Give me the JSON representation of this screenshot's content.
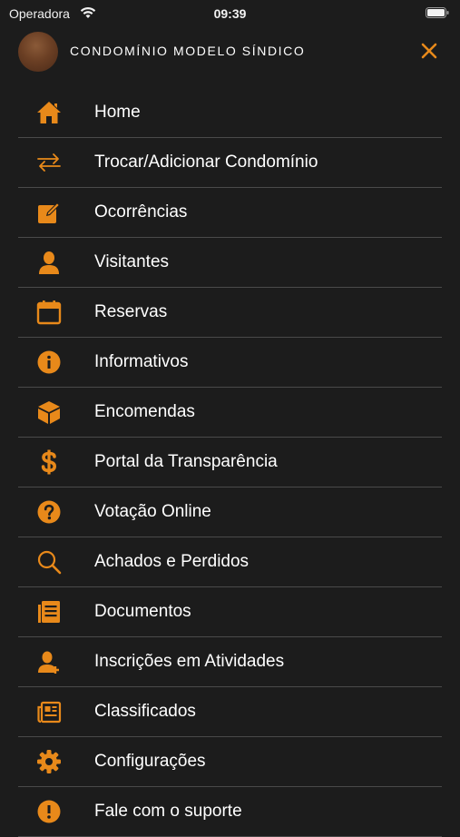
{
  "status_bar": {
    "carrier": "Operadora",
    "time": "09:39"
  },
  "header": {
    "title": "CONDOMÍNIO MODELO SÍNDICO"
  },
  "colors": {
    "accent": "#e8891a",
    "background": "#1c1c1c",
    "divider": "#4a4a4a"
  },
  "menu": {
    "items": [
      {
        "label": "Home",
        "icon": "home-icon"
      },
      {
        "label": "Trocar/Adicionar Condomínio",
        "icon": "swap-arrows-icon"
      },
      {
        "label": "Ocorrências",
        "icon": "edit-note-icon"
      },
      {
        "label": "Visitantes",
        "icon": "person-icon"
      },
      {
        "label": "Reservas",
        "icon": "calendar-icon"
      },
      {
        "label": "Informativos",
        "icon": "info-icon"
      },
      {
        "label": "Encomendas",
        "icon": "package-icon"
      },
      {
        "label": "Portal da Transparência",
        "icon": "dollar-icon"
      },
      {
        "label": "Votação Online",
        "icon": "question-icon"
      },
      {
        "label": "Achados e Perdidos",
        "icon": "search-icon"
      },
      {
        "label": "Documentos",
        "icon": "document-icon"
      },
      {
        "label": "Inscrições em Atividades",
        "icon": "person-add-icon"
      },
      {
        "label": "Classificados",
        "icon": "newspaper-icon"
      },
      {
        "label": "Configurações",
        "icon": "gear-icon"
      },
      {
        "label": "Fale com o suporte",
        "icon": "support-icon"
      }
    ]
  }
}
